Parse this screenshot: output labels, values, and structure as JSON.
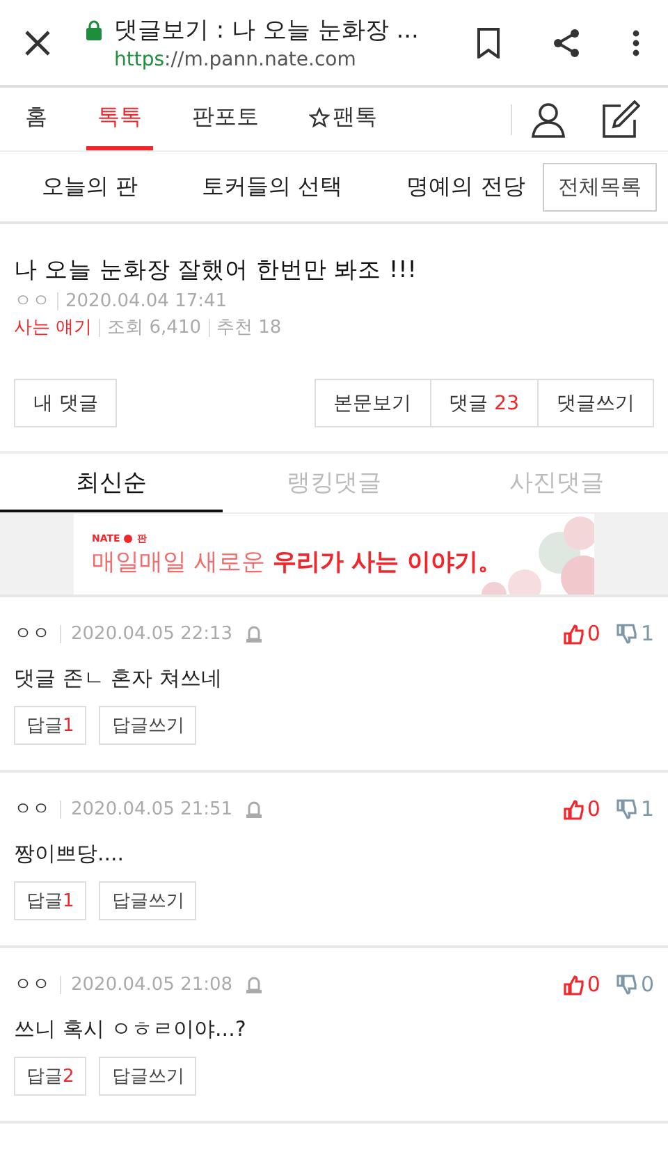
{
  "browser": {
    "title": "댓글보기 : 나 오늘 눈화장 ...",
    "url_scheme": "https",
    "url_rest": "://m.pann.nate.com"
  },
  "nav": {
    "items": [
      {
        "label": "홈",
        "selected": false,
        "kind": "plain"
      },
      {
        "label": "톡톡",
        "selected": true,
        "kind": "plain"
      },
      {
        "label": "판포토",
        "selected": false,
        "kind": "plain"
      },
      {
        "label": "팬톡",
        "selected": false,
        "kind": "starred"
      }
    ]
  },
  "subnav": {
    "items": [
      "오늘의 판",
      "토커들의 선택",
      "명예의 전당"
    ],
    "all_button": "전체목록"
  },
  "post": {
    "title": "나 오늘 눈화장 잘했어 한번만 봐조 !!!",
    "author": "ㅇㅇ",
    "date": "2020.04.04 17:41",
    "category": "사는 얘기",
    "views": "조회 6,410",
    "recommends": "추천 18",
    "my_comments": "내 댓글",
    "view_body": "본문보기",
    "comments_label": "댓글",
    "comments_count": "23",
    "write": "댓글쓰기"
  },
  "sort_tabs": [
    {
      "label": "최신순",
      "selected": true
    },
    {
      "label": "랭킹댓글",
      "selected": false
    },
    {
      "label": "사진댓글",
      "selected": false
    }
  ],
  "banner": {
    "brand": "NATE",
    "brand_sub": "판",
    "text": "매일매일 새로운 **우리가 사는 이야기。**"
  },
  "comments": [
    {
      "author": "ㅇㅇ",
      "date": "2020.04.05 22:13",
      "text": "댓글 존ㄴ 혼자 쳐쓰네",
      "likes": "0",
      "dislikes": "1",
      "reply_label": "답글",
      "reply_count": "1",
      "write_reply": "답글쓰기"
    },
    {
      "author": "ㅇㅇ",
      "date": "2020.04.05 21:51",
      "text": "짱이쁘당....",
      "likes": "0",
      "dislikes": "1",
      "reply_label": "답글",
      "reply_count": "1",
      "write_reply": "답글쓰기"
    },
    {
      "author": "ㅇㅇ",
      "date": "2020.04.05 21:08",
      "text": "쓰니 혹시 ㅇㅎㄹ이야...?",
      "likes": "0",
      "dislikes": "0",
      "reply_label": "답글",
      "reply_count": "2",
      "write_reply": "답글쓰기"
    }
  ]
}
